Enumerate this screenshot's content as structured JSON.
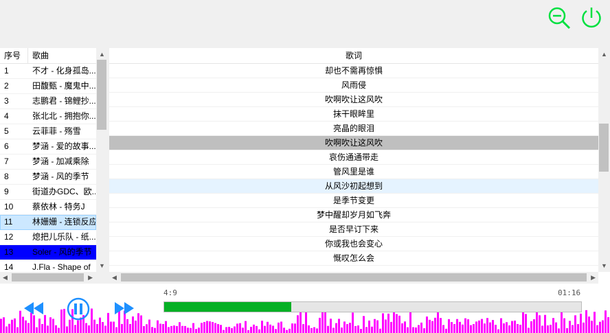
{
  "song_list": {
    "headers": {
      "num": "序号",
      "title": "歌曲"
    },
    "rows": [
      {
        "num": "1",
        "title": "不才 - 化身孤岛..."
      },
      {
        "num": "2",
        "title": "田馥甄 - 魔鬼中..."
      },
      {
        "num": "3",
        "title": "志鹏君 - 锦鲤抄..."
      },
      {
        "num": "4",
        "title": "张北北 - 拥抱你..."
      },
      {
        "num": "5",
        "title": "云菲菲 - 殇雪"
      },
      {
        "num": "6",
        "title": "梦涵 - 爱的故事..."
      },
      {
        "num": "7",
        "title": "梦涵 - 加减乘除"
      },
      {
        "num": "8",
        "title": "梦涵 - 风的季节"
      },
      {
        "num": "9",
        "title": "街道办GDC、欧..."
      },
      {
        "num": "10",
        "title": "蔡依林 - 特务J"
      },
      {
        "num": "11",
        "title": "林姗姗 - 连锁反应"
      },
      {
        "num": "12",
        "title": "熄把儿乐队 - 纸..."
      },
      {
        "num": "13",
        "title": "Soler - 风的季节"
      },
      {
        "num": "14",
        "title": "J.Fla - Shape of"
      }
    ],
    "selected_index": 10,
    "playing_index": 12
  },
  "lyrics": {
    "header": "歌词",
    "lines": [
      "却也不需再惊惧",
      "风雨侵",
      "吹啊吹让这风吹",
      "抹干眼眸里",
      "亮晶的眼泪",
      "吹啊吹让这风吹",
      "哀伤通通带走",
      "管风里是谁",
      "从风沙初起想到",
      "是季节变更",
      "梦中醒却岁月如飞奔",
      "是否早订下来",
      "你或我也会变心",
      "慨叹怎么会"
    ],
    "current_index": 5,
    "hover_index": 8
  },
  "player": {
    "time_current": "4:9",
    "time_total": "01:16",
    "progress": 0.305
  },
  "icons": {
    "zoom": "zoom-out-icon",
    "power": "power-icon",
    "prev": "previous-icon",
    "pause": "pause-icon",
    "next": "next-icon"
  },
  "colors": {
    "accent_green": "#00e040",
    "progress_fill": "#06b025",
    "playing_row": "#0000ff",
    "controls_blue": "#1e90ff",
    "visualizer": "#ff00ff"
  }
}
